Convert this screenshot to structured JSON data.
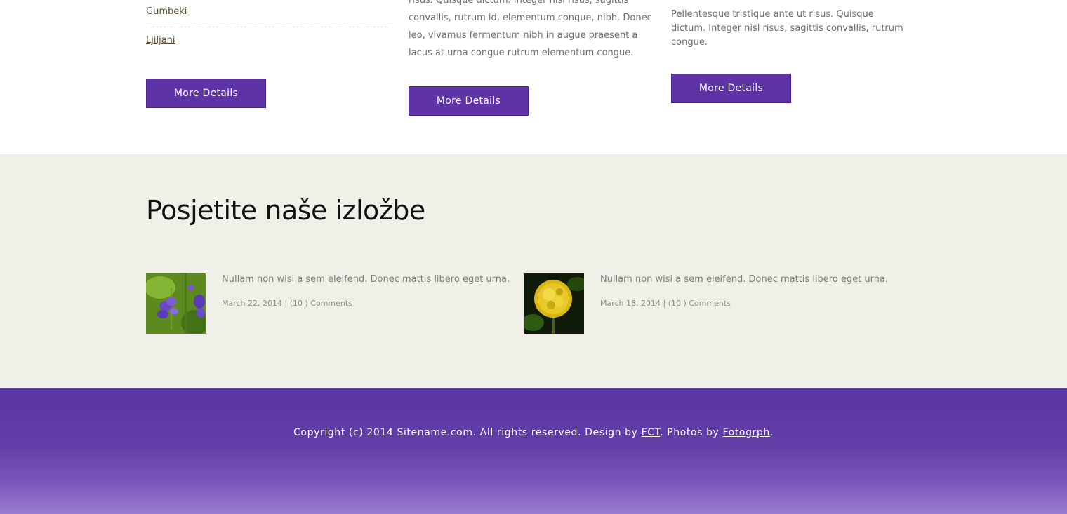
{
  "top_section": {
    "col1": {
      "links": [
        "Gumbeki",
        "Ljiljani"
      ],
      "button_label": "More Details"
    },
    "col2": {
      "paragraph": "risus. Quisque dictum. Integer nisl risus, sagittis convallis, rutrum id, elementum congue, nibh. Donec leo, vivamus fermentum nibh in augue praesent a lacus at urna congue rutrum elementum congue.",
      "button_label": "More Details"
    },
    "col3": {
      "paragraph": "Pellentesque tristique ante ut risus. Quisque dictum. Integer nisl risus, sagittis convallis, rutrum congue.",
      "button_label": "More Details"
    }
  },
  "exhibitions": {
    "title": "Posjetite naše izložbe",
    "posts": [
      {
        "text": "Nullam non wisi a sem eleifend. Donec mattis libero eget urna.",
        "date": "March 22, 2014",
        "separator": " | ",
        "comments": "(10 ) Comments",
        "image": "purple-flower"
      },
      {
        "text": "Nullam non wisi a sem eleifend. Donec mattis libero eget urna.",
        "date": "March 18, 2014",
        "separator": " | ",
        "comments": "(10 ) Comments",
        "image": "yellow-marigold"
      }
    ]
  },
  "footer": {
    "copyright_prefix": "Copyright (c) 2014 Sitename.com. All rights reserved. Design by ",
    "design_link": "FCT",
    "photos_prefix": ". Photos by ",
    "photos_link": "Fotogrph",
    "suffix": "."
  },
  "colors": {
    "accent": "#5d33a5",
    "expo_bg": "#f0f0e9",
    "footer_top": "#5a36a4",
    "footer_bottom": "#9a7cd0"
  }
}
